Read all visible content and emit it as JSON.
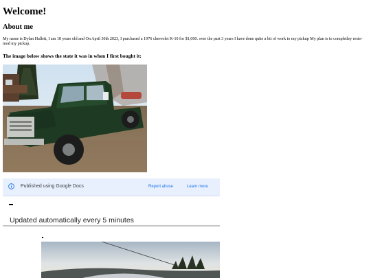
{
  "header": {
    "title": "Welcome!"
  },
  "about": {
    "heading": "About me",
    "bio": "My name is Dylan Hallett, I am 18 years old and On April 30th 2023, I purchased a 1976 chevrolet K-10 for $1,000. over the past 3 years I have done quite a bit of work to my pickup My plan is to completley resto-mod my pickup.",
    "photo_caption": "The image below shows the state it was in when I first bought it:"
  },
  "google_bar": {
    "published_label": "Published using Google Docs",
    "report_abuse": "Report abuse",
    "learn_more": "Learn more",
    "icon": "info-icon",
    "accent": "#1a73e8",
    "background": "#e8f0fe"
  },
  "footer": {
    "updated_label": "Updated automatically every 5 minutes"
  }
}
